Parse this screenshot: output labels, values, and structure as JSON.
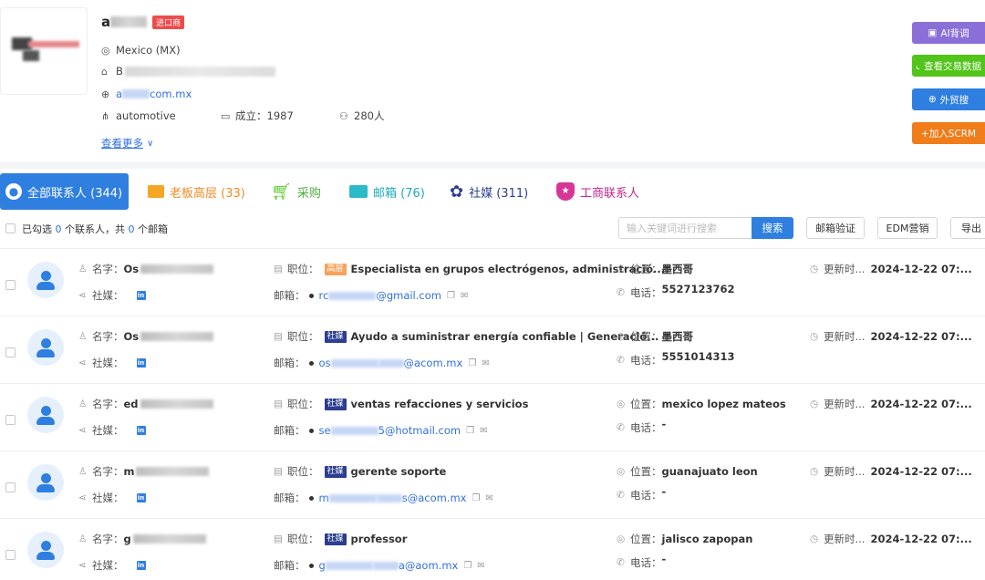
{
  "company": {
    "name_initial": "a",
    "badge": "进口商",
    "country": "Mexico (MX)",
    "address_initial": "B",
    "website_prefix": "a",
    "website_suffix": "com.mx",
    "industry": "automotive",
    "founded_label": "成立：",
    "founded": "1987",
    "employees": "280人",
    "more_label": "查看更多"
  },
  "side_buttons": {
    "ai": "AI背调",
    "trade": "查看交易数据",
    "foreign": "外贸搜",
    "scrm": "+加入SCRM"
  },
  "tabs": {
    "all": "全部联系人 (344)",
    "boss": "老板高层 (33)",
    "purchase": "采购",
    "email": "邮箱 (76)",
    "social": "社媒 (311)",
    "business": "工商联系人"
  },
  "toolbar": {
    "sel_prefix": "已勾选 ",
    "sel_count": "0",
    "sel_mid": " 个联系人，共 ",
    "total_count": "0",
    "sel_suffix": " 个邮箱",
    "search_placeholder": "输入关键词进行搜索",
    "search_button": "搜索",
    "verify": "邮箱验证",
    "edm": "EDM营销",
    "export": "导出"
  },
  "labels": {
    "name": "名字：",
    "social": "社媒：",
    "position": "职位：",
    "email": "邮箱：",
    "location": "位置：",
    "phone": "电话：",
    "updated": "更新时...",
    "linkedin": "in"
  },
  "contacts": [
    {
      "name_prefix": "Os",
      "tag": "高层",
      "tag_color": "#f7a35c",
      "position": "Especialista en grupos electrógenos, administració...",
      "email_prefix": "rc",
      "email_suffix": "@gmail.com",
      "location": "墨西哥",
      "phone": "5527123762",
      "updated": "2024-12-22 07:..."
    },
    {
      "name_prefix": "Os",
      "tag": "社媒",
      "tag_color": "#2b3e8f",
      "position": "Ayudo a suministrar energía confiable | Generació...",
      "email_prefix": "os",
      "email_mid": "@a",
      "email_suffix": "com.mx",
      "location": "墨西哥",
      "phone": "5551014313",
      "updated": "2024-12-22 07:..."
    },
    {
      "name_prefix": "ed",
      "tag": "社媒",
      "tag_color": "#2b3e8f",
      "position": "ventas refacciones y servicios",
      "email_prefix": "se",
      "email_suffix": "5@hotmail.com",
      "location": "mexico lopez mateos",
      "phone": "-",
      "updated": "2024-12-22 07:..."
    },
    {
      "name_prefix": "m",
      "tag": "社媒",
      "tag_color": "#2b3e8f",
      "position": "gerente soporte",
      "email_prefix": "m",
      "email_mid": "s@a",
      "email_suffix": "com.mx",
      "location": "guanajuato leon",
      "phone": "-",
      "updated": "2024-12-22 07:..."
    },
    {
      "name_prefix": "g",
      "tag": "社媒",
      "tag_color": "#2b3e8f",
      "position": "professor",
      "email_prefix": "g",
      "email_mid": "a@a",
      "email_suffix": "om.mx",
      "location": "jalisco zapopan",
      "phone": "-",
      "updated": "2024-12-22 07:..."
    }
  ]
}
